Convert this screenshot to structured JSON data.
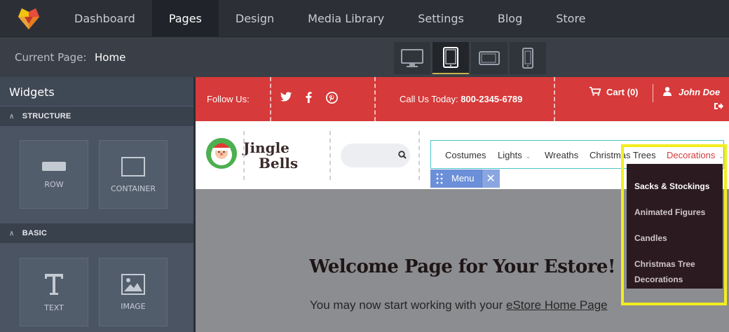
{
  "topnav": {
    "items": [
      "Dashboard",
      "Pages",
      "Design",
      "Media Library",
      "Settings",
      "Blog",
      "Store"
    ],
    "active": "Pages"
  },
  "subbar": {
    "current_page_label": "Current Page:",
    "current_page_value": "Home",
    "devices": [
      "desktop-icon",
      "tablet-portrait-icon",
      "tablet-landscape-icon",
      "mobile-icon"
    ],
    "active_device": "tablet-portrait-icon"
  },
  "sidebar": {
    "title": "Widgets",
    "sections": [
      {
        "label": "STRUCTURE",
        "widgets": [
          {
            "label": "ROW",
            "icon": "row-icon"
          },
          {
            "label": "CONTAINER",
            "icon": "container-icon"
          }
        ]
      },
      {
        "label": "BASIC",
        "widgets": [
          {
            "label": "TEXT",
            "icon": "text-icon"
          },
          {
            "label": "IMAGE",
            "icon": "image-icon"
          }
        ]
      }
    ]
  },
  "site": {
    "topbar": {
      "follow_label": "Follow Us:",
      "social": [
        "twitter-icon",
        "facebook-icon",
        "pinterest-icon"
      ],
      "call_label": "Call Us Today:",
      "phone": "800-2345-6789",
      "cart_label": "Cart (0)",
      "user_name": "John Doe"
    },
    "brand": {
      "line1": "Jingle",
      "line2": "Bells"
    },
    "search": {
      "placeholder": ""
    },
    "menu": {
      "items": [
        "Costumes",
        "Lights",
        "Wreaths",
        "Christmas Trees",
        "Decorations"
      ],
      "active": "Decorations",
      "tag_label": "Menu"
    },
    "dropdown": {
      "items": [
        "Sacks & Stockings",
        "Animated Figures",
        "Candles",
        "Christmas Tree Decorations"
      ],
      "item4_line1": "Christmas Tree",
      "item4_line2": "Decorations"
    },
    "welcome_title": "Welcome Page for Your Estore!",
    "subtext_prefix": "You may now start working with your",
    "subtext_link": "eStore Home Page"
  },
  "colors": {
    "accent_red": "#d63a3a",
    "highlight_yellow": "#f2ee1f",
    "menu_tag_blue": "#6b8fd8"
  }
}
